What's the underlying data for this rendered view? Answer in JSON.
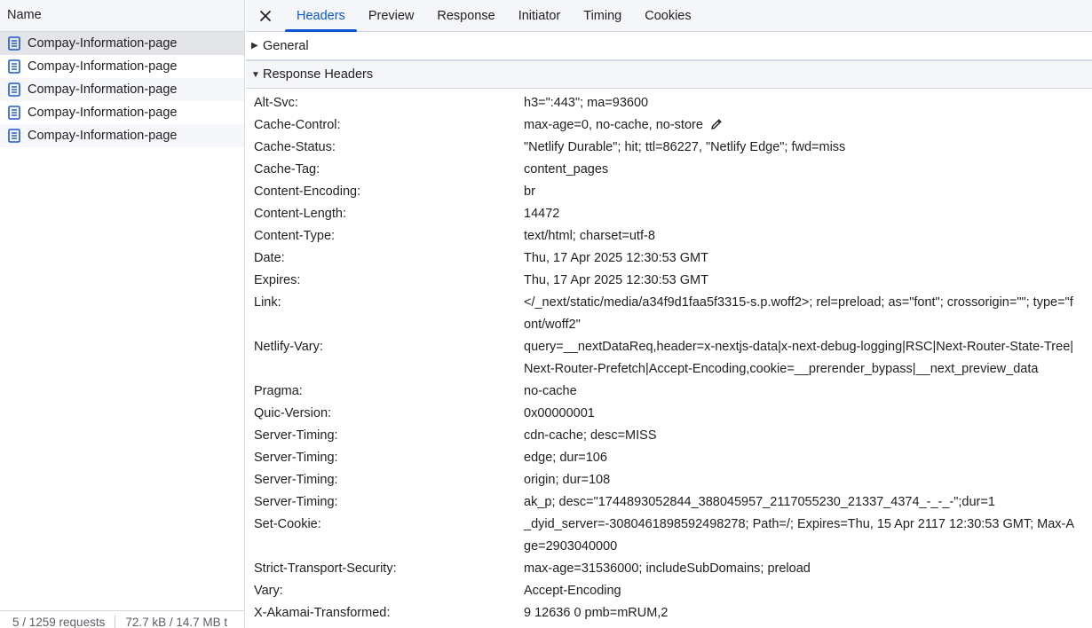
{
  "left": {
    "column_header": "Name",
    "requests": [
      "Compay-Information-page",
      "Compay-Information-page",
      "Compay-Information-page",
      "Compay-Information-page",
      "Compay-Information-page"
    ],
    "status": {
      "requests": "5 / 1259 requests",
      "transferred": "72.7 kB / 14.7 MB t"
    }
  },
  "tabs": [
    "Headers",
    "Preview",
    "Response",
    "Initiator",
    "Timing",
    "Cookies"
  ],
  "sections": {
    "general": "General",
    "response_headers": "Response Headers"
  },
  "headers": [
    {
      "name": "Alt-Svc:",
      "value": "h3=\":443\"; ma=93600"
    },
    {
      "name": "Cache-Control:",
      "value": "max-age=0, no-cache, no-store"
    },
    {
      "name": "Cache-Status:",
      "value": "\"Netlify Durable\"; hit; ttl=86227, \"Netlify Edge\"; fwd=miss"
    },
    {
      "name": "Cache-Tag:",
      "value": "content_pages"
    },
    {
      "name": "Content-Encoding:",
      "value": "br"
    },
    {
      "name": "Content-Length:",
      "value": "14472"
    },
    {
      "name": "Content-Type:",
      "value": "text/html; charset=utf-8"
    },
    {
      "name": "Date:",
      "value": "Thu, 17 Apr 2025 12:30:53 GMT"
    },
    {
      "name": "Expires:",
      "value": "Thu, 17 Apr 2025 12:30:53 GMT"
    },
    {
      "name": "Link:",
      "value": "</_next/static/media/a34f9d1faa5f3315-s.p.woff2>; rel=preload; as=\"font\"; crossorigin=\"\"; type=\"font/woff2\""
    },
    {
      "name": "Netlify-Vary:",
      "value": "query=__nextDataReq,header=x-nextjs-data|x-next-debug-logging|RSC|Next-Router-State-Tree|Next-Router-Prefetch|Accept-Encoding,cookie=__prerender_bypass|__next_preview_data"
    },
    {
      "name": "Pragma:",
      "value": "no-cache"
    },
    {
      "name": "Quic-Version:",
      "value": "0x00000001"
    },
    {
      "name": "Server-Timing:",
      "value": "cdn-cache; desc=MISS"
    },
    {
      "name": "Server-Timing:",
      "value": "edge; dur=106"
    },
    {
      "name": "Server-Timing:",
      "value": "origin; dur=108"
    },
    {
      "name": "Server-Timing:",
      "value": "ak_p; desc=\"1744893052844_388045957_2117055230_21337_4374_-_-_-\";dur=1"
    },
    {
      "name": "Set-Cookie:",
      "value": "_dyid_server=-3080461898592498278; Path=/; Expires=Thu, 15 Apr 2117 12:30:53 GMT; Max-Age=2903040000"
    },
    {
      "name": "Strict-Transport-Security:",
      "value": "max-age=31536000; includeSubDomains; preload"
    },
    {
      "name": "Vary:",
      "value": "Accept-Encoding"
    },
    {
      "name": "X-Akamai-Transformed:",
      "value": "9 12636 0 pmb=mRUM,2"
    }
  ],
  "icons": {
    "close": "close-icon",
    "document": "document-icon",
    "edit": "pencil-icon"
  },
  "colors": {
    "accent": "#0b57d0",
    "selected_row": "#e3e5e9",
    "header_bg": "#f4f6fa"
  }
}
